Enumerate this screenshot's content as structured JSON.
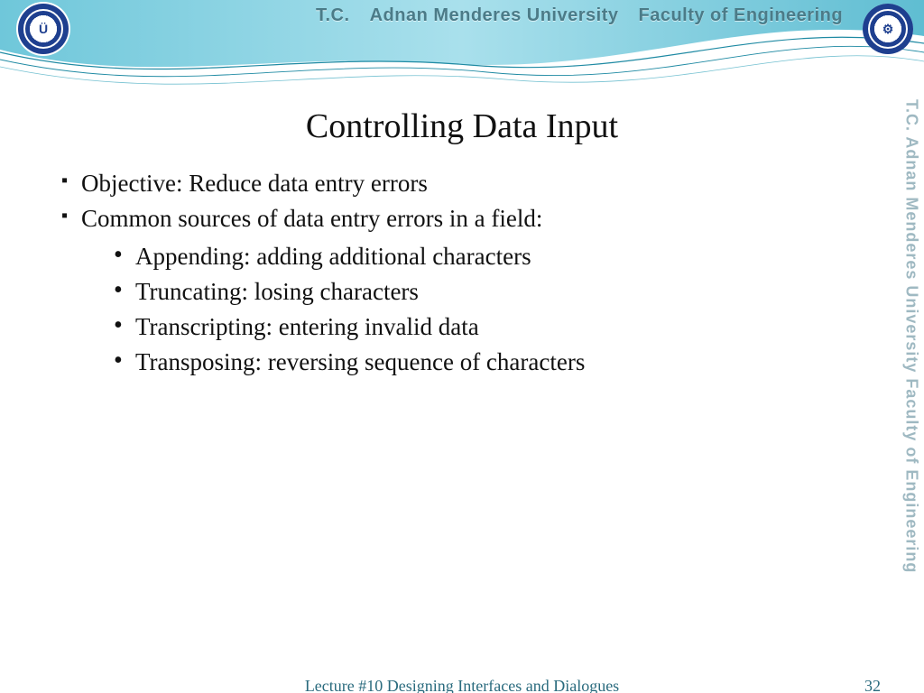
{
  "header": {
    "tc": "T.C.",
    "university": "Adnan Menderes University",
    "faculty": "Faculty of Engineering"
  },
  "sidebar": {
    "text": "T.C.   Adnan Menderes University   Faculty of Engineering"
  },
  "slide": {
    "title": "Controlling Data Input",
    "bullets": [
      "Objective: Reduce data entry errors",
      "Common sources of data entry errors in a field:"
    ],
    "sub_bullets": [
      "Appending: adding additional characters",
      "Truncating: losing characters",
      "Transcripting: entering invalid data",
      "Transposing: reversing sequence of characters"
    ]
  },
  "footer": {
    "lecture": "Lecture #10 Designing Interfaces and Dialogues",
    "page": "32"
  },
  "logos": {
    "left_initial": "Ü",
    "right_initial": "⚙"
  }
}
